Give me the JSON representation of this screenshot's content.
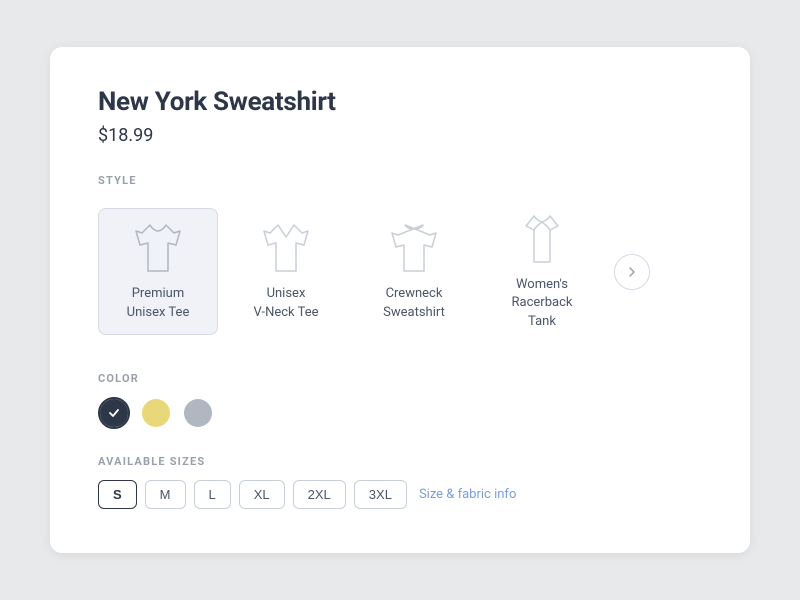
{
  "product": {
    "title": "New York Sweatshirt",
    "price": "$18.99"
  },
  "style_section": {
    "label": "STYLE",
    "options": [
      {
        "id": "premium-unisex-tee",
        "label": "Premium\nUnisex Tee",
        "selected": true
      },
      {
        "id": "unisex-vneck-tee",
        "label": "Unisex\nV-Neck Tee",
        "selected": false
      },
      {
        "id": "crewneck-sweatshirt",
        "label": "Crewneck\nSweatshirt",
        "selected": false
      },
      {
        "id": "womens-racerback-tank",
        "label": "Women's\nRacerback Tank",
        "selected": false
      }
    ],
    "next_button_label": "›"
  },
  "color_section": {
    "label": "COLOR",
    "options": [
      {
        "id": "dark-navy",
        "color": "#2d3748",
        "selected": true
      },
      {
        "id": "pale-yellow",
        "color": "#e8d87a",
        "selected": false
      },
      {
        "id": "light-grey",
        "color": "#b0b7c1",
        "selected": false
      }
    ]
  },
  "sizes_section": {
    "label": "AVAILABLE SIZES",
    "sizes": [
      "S",
      "M",
      "L",
      "XL",
      "2XL",
      "3XL"
    ],
    "selected": "S",
    "fabric_link": "Size & fabric info"
  }
}
